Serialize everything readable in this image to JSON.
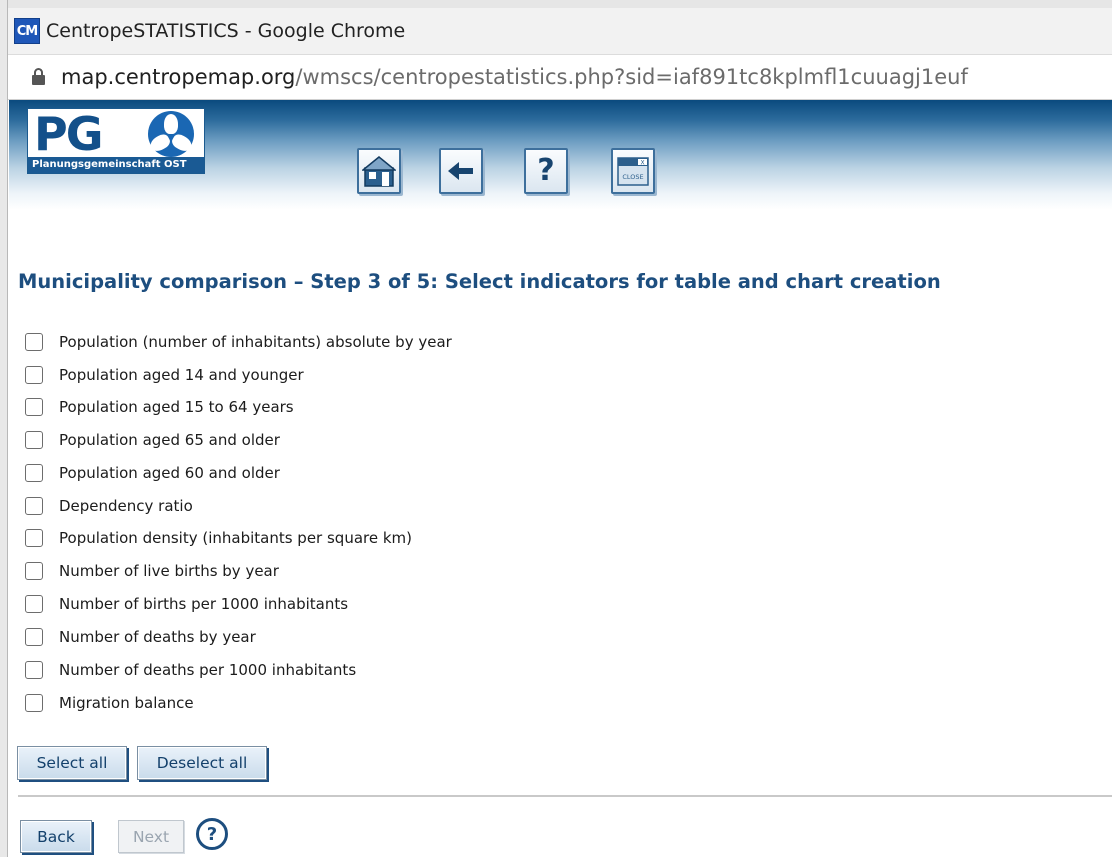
{
  "browser": {
    "favicon_text": "CM",
    "window_title": "CentropeSTATISTICS - Google Chrome",
    "url_host": "map.centropemap.org",
    "url_path": "/wmscs/centropestatistics.php?sid=iaf891tc8kplmfl1cuuagj1euf"
  },
  "banner": {
    "logo_letters": "PG",
    "logo_caption": "Planungsgemeinschaft OST",
    "toolbar": [
      {
        "name": "home",
        "icon": "home-icon"
      },
      {
        "name": "back",
        "icon": "arrow-left-icon"
      },
      {
        "name": "help",
        "icon": "question-icon",
        "glyph": "?"
      },
      {
        "name": "close",
        "icon": "close-window-icon",
        "tag_x": "X",
        "tag_close": "CLOSE"
      }
    ]
  },
  "page": {
    "heading": "Municipality comparison – Step 3 of 5: Select indicators for table and chart creation"
  },
  "indicators": [
    {
      "label": "Population (number of inhabitants) absolute by year",
      "checked": false
    },
    {
      "label": "Population aged 14 and younger",
      "checked": false
    },
    {
      "label": "Population aged 15 to 64 years",
      "checked": false
    },
    {
      "label": "Population aged 65 and older",
      "checked": false
    },
    {
      "label": "Population aged 60 and older",
      "checked": false
    },
    {
      "label": "Dependency ratio",
      "checked": false
    },
    {
      "label": "Population density (inhabitants per square km)",
      "checked": false
    },
    {
      "label": "Number of live births by year",
      "checked": false
    },
    {
      "label": "Number of births per 1000 inhabitants",
      "checked": false
    },
    {
      "label": "Number of deaths by year",
      "checked": false
    },
    {
      "label": "Number of deaths per 1000 inhabitants",
      "checked": false
    },
    {
      "label": "Migration balance",
      "checked": false
    }
  ],
  "actions": {
    "select_all": "Select all",
    "deselect_all": "Deselect all",
    "back": "Back",
    "next": "Next",
    "help_glyph": "?"
  },
  "colors": {
    "heading": "#1d4e7f",
    "banner_dark": "#0a4a7e",
    "button_shadow": "#1f4f80"
  }
}
